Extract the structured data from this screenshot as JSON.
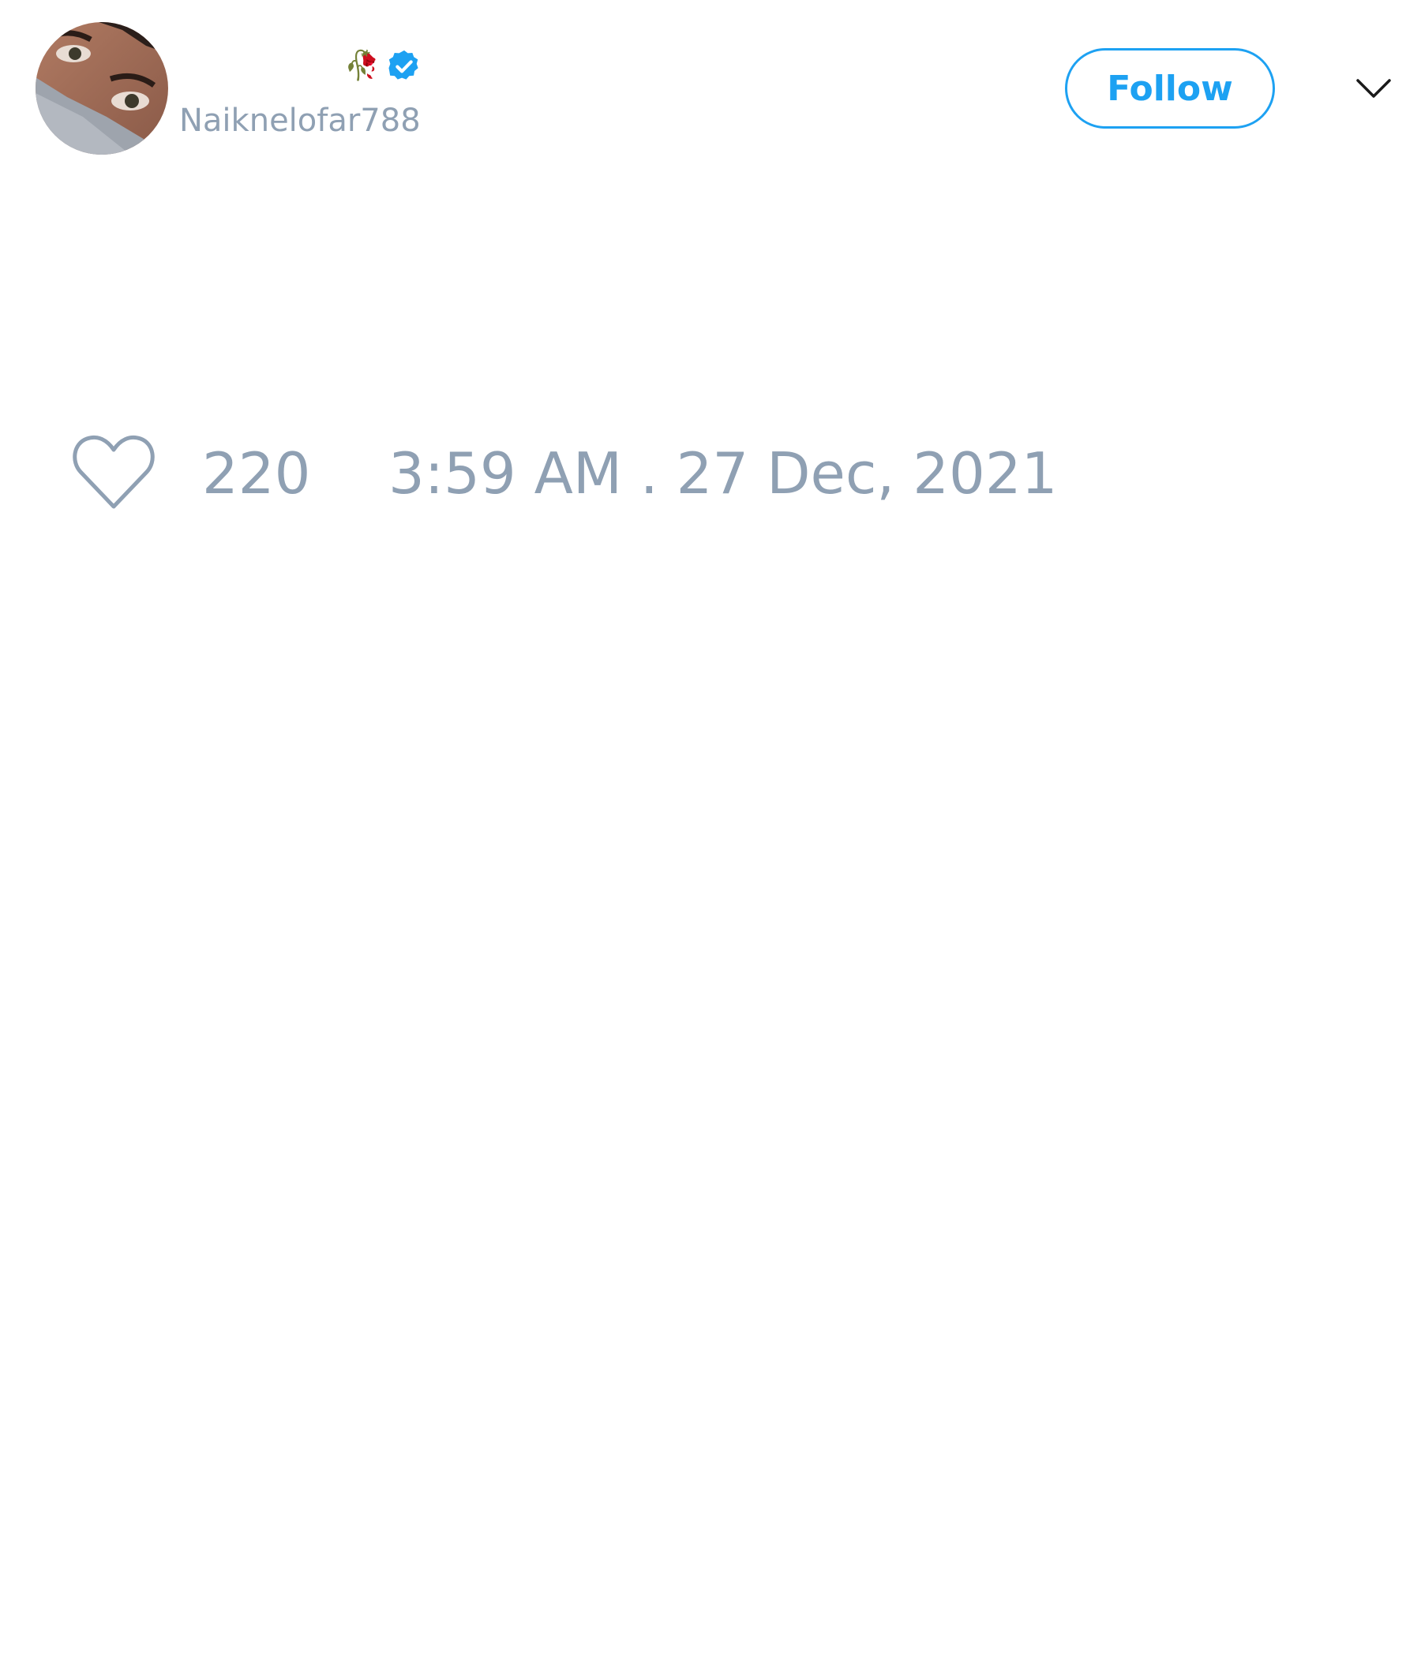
{
  "tweet": {
    "author": {
      "display_name": "🥀",
      "handle": "Naiknelofar788",
      "verified": true,
      "avatar_icon": "profile-photo"
    },
    "follow_label": "Follow",
    "menu_icon": "chevron-down-icon",
    "like_icon": "heart-icon",
    "like_count": "220",
    "timestamp": "3:59 AM . 27 Dec, 2021"
  },
  "colors": {
    "accent": "#1da1f2",
    "muted_text": "#8fa0b3",
    "background": "#ffffff"
  }
}
